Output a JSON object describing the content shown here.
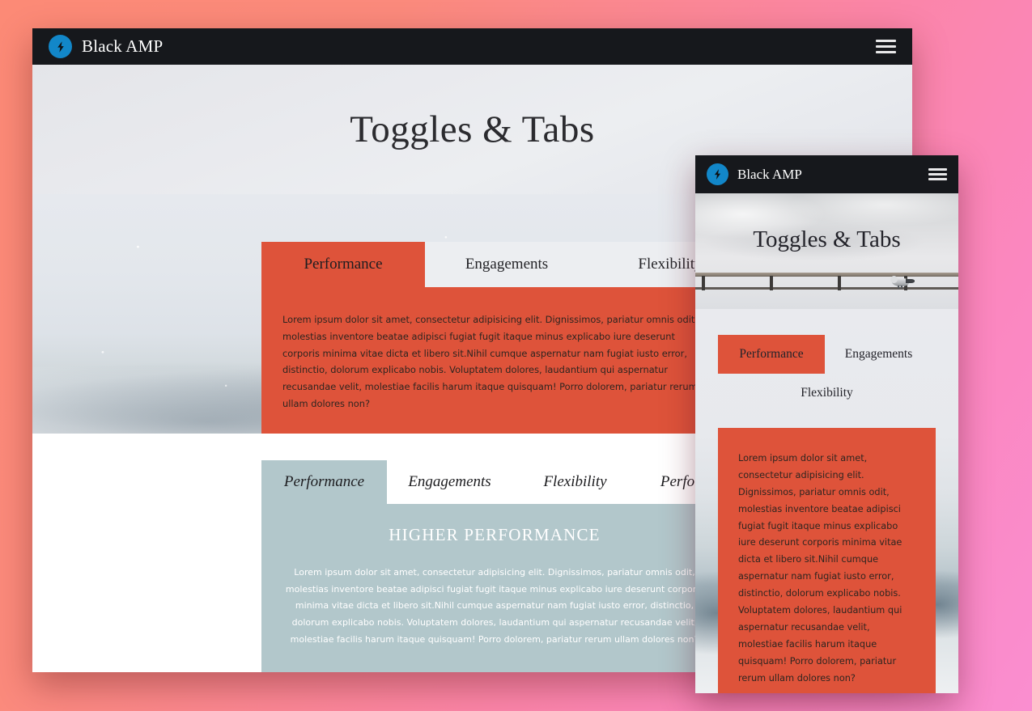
{
  "theme": {
    "accent_red": "#de533a",
    "accent_blue": "#b2c7cb",
    "navbar_bg": "#16181c",
    "logo_blue": "#1287c9",
    "page_bg_left": "#fc8a76",
    "page_bg_right": "#fa8ed0"
  },
  "desktop": {
    "navbar": {
      "brand": "Black AMP",
      "logo_icon": "amp-bolt-icon",
      "menu_icon": "hamburger-menu-icon"
    },
    "hero": {
      "title": "Toggles & Tabs"
    },
    "tabs_one": {
      "tabs": [
        {
          "label": "Performance",
          "active": true
        },
        {
          "label": "Engagements",
          "active": false
        },
        {
          "label": "Flexibility",
          "active": false
        }
      ],
      "body": "Lorem ipsum dolor sit amet, consectetur adipisicing elit. Dignissimos, pariatur omnis odit, molestias inventore beatae adipisci fugiat fugit itaque minus explicabo iure deserunt corporis minima vitae dicta et libero sit.Nihil cumque aspernatur nam fugiat iusto error, distinctio, dolorum explicabo nobis. Voluptatem dolores, laudantium qui aspernatur recusandae velit, molestiae facilis harum itaque quisquam! Porro dolorem, pariatur rerum ullam dolores non?"
    },
    "tabs_two": {
      "tabs": [
        {
          "label": "Performance",
          "active": true
        },
        {
          "label": "Engagements",
          "active": false
        },
        {
          "label": "Flexibility",
          "active": false
        },
        {
          "label": "Performance",
          "active": false
        }
      ],
      "heading": "HIGHER PERFORMANCE",
      "body": "Lorem ipsum dolor sit amet, consectetur adipisicing elit. Dignissimos, pariatur omnis odit, molestias inventore beatae adipisci fugiat fugit itaque minus explicabo iure deserunt corporis minima vitae dicta et libero sit.Nihil cumque aspernatur nam fugiat iusto error, distinctio, dolorum explicabo nobis. Voluptatem dolores, laudantium qui aspernatur recusandae velit, molestiae facilis harum itaque quisquam! Porro dolorem, pariatur rerum ullam dolores non?"
    }
  },
  "mobile": {
    "navbar": {
      "brand": "Black AMP",
      "logo_icon": "amp-bolt-icon",
      "menu_icon": "hamburger-menu-icon"
    },
    "hero": {
      "title": "Toggles & Tabs"
    },
    "tabs": {
      "tabs": [
        {
          "label": "Performance",
          "active": true
        },
        {
          "label": "Engagements",
          "active": false
        },
        {
          "label": "Flexibility",
          "active": false
        }
      ],
      "body": "Lorem ipsum dolor sit amet, consectetur adipisicing elit. Dignissimos, pariatur omnis odit, molestias inventore beatae adipisci fugiat fugit itaque minus explicabo iure deserunt corporis minima vitae dicta et libero sit.Nihil cumque aspernatur nam fugiat iusto error, distinctio, dolorum explicabo nobis. Voluptatem dolores, laudantium qui aspernatur recusandae velit, molestiae facilis harum itaque quisquam! Porro dolorem, pariatur rerum ullam dolores non?"
    }
  }
}
